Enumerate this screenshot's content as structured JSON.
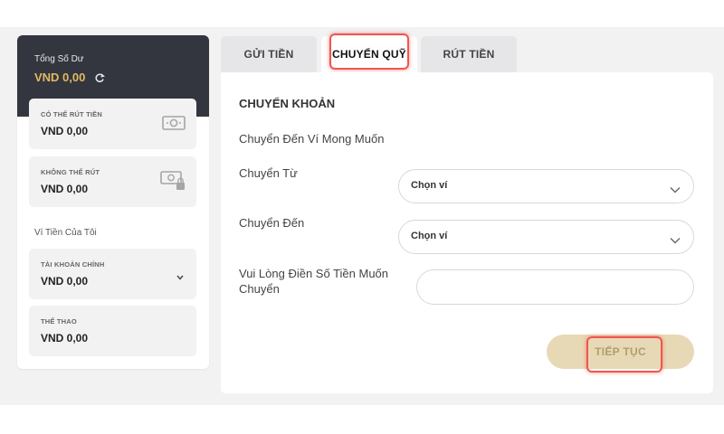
{
  "sidebar": {
    "title": "Tổng Số Dư",
    "total": "VND  0,00",
    "cards": [
      {
        "label": "CÓ THỂ RÚT TIỀN",
        "value": "VND  0,00",
        "icon": "cash-icon"
      },
      {
        "label": "KHÔNG THỂ RÚT",
        "value": "VND  0,00",
        "icon": "cash-lock-icon"
      }
    ],
    "wallet_section": "Ví Tiền Của Tôi",
    "wallets": [
      {
        "label": "TÀI KHOẢN CHÍNH",
        "value": "VND  0,00"
      },
      {
        "label": "THỂ THAO",
        "value": "VND  0,00"
      }
    ]
  },
  "tabs": [
    {
      "label": "GỬI TIỀN"
    },
    {
      "label": "CHUYỂN QUỸ",
      "active": true
    },
    {
      "label": "RÚT TIỀN"
    }
  ],
  "panel": {
    "title": "CHUYỂN KHOẢN",
    "subtitle": "Chuyển Đến Ví Mong Muốn",
    "from_label": "Chuyển Từ",
    "from_value": "Chọn ví",
    "to_label": "Chuyển Đến",
    "to_value": "Chọn ví",
    "amount_label_line1": "Vui Lòng Điền Số Tiền Muốn",
    "amount_label_line2": "Chuyển",
    "amount_value": "",
    "submit_label": "TIẾP TỤC"
  },
  "colors": {
    "header_dark": "#33363f",
    "gold": "#e3b95f",
    "button_bg": "#e8d9b6",
    "highlight_red": "#f0564f"
  }
}
